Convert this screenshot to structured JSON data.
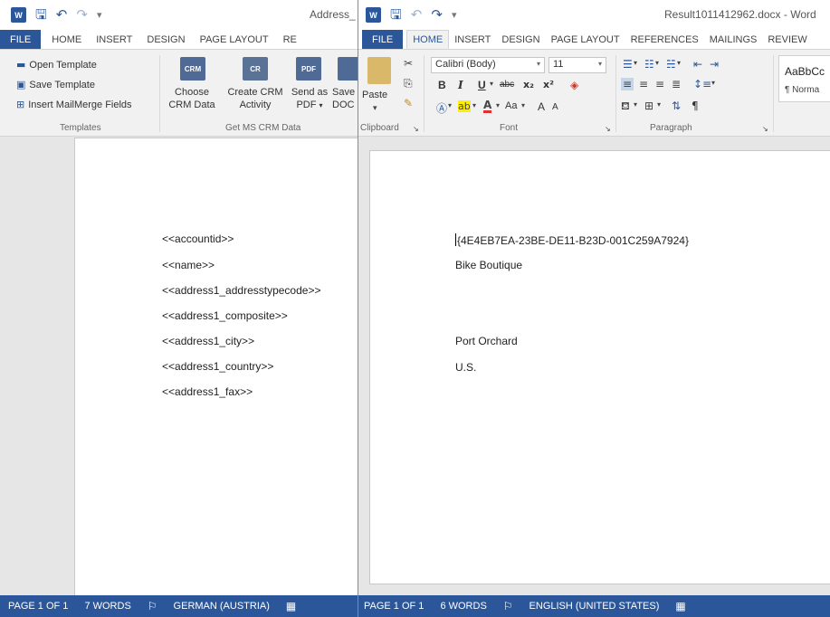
{
  "left_window": {
    "doc_title": "Address_",
    "tabs": [
      "FILE",
      "HOME",
      "INSERT",
      "DESIGN",
      "PAGE LAYOUT",
      "RE"
    ],
    "ribbon": {
      "open_template": "Open Template",
      "save_template": "Save Template",
      "insert_mailmerge": "Insert MailMerge Fields",
      "group_templates": "Templates",
      "choose_crm_1": "Choose",
      "choose_crm_2": "CRM Data",
      "create_activity_1": "Create CRM",
      "create_activity_2": "Activity",
      "send_pdf_1": "Send as",
      "send_pdf_2": "PDF",
      "save_doc_1": "Save",
      "save_doc_2": "DOC",
      "group_get_crm": "Get MS CRM Data",
      "icon_crm": "CRM",
      "icon_cr": "CR",
      "icon_pdf": "PDF"
    },
    "document_lines": [
      "<<accountid>>",
      "<<name>>",
      "<<address1_addresstypecode>>",
      "<<address1_composite>>",
      "<<address1_city>>",
      "<<address1_country>>",
      "<<address1_fax>>"
    ],
    "status": {
      "page": "PAGE 1 OF 1",
      "words": "7 WORDS",
      "language": "GERMAN (AUSTRIA)"
    }
  },
  "right_window": {
    "doc_title": "Result1011412962.docx - Word",
    "tabs": [
      "FILE",
      "HOME",
      "INSERT",
      "DESIGN",
      "PAGE LAYOUT",
      "REFERENCES",
      "MAILINGS",
      "REVIEW"
    ],
    "ribbon": {
      "paste": "Paste",
      "font_name": "Calibri (Body)",
      "font_size": "11",
      "group_clipboard": "Clipboard",
      "group_font": "Font",
      "group_paragraph": "Paragraph",
      "style_preview": "AaBbCc",
      "style_name": "¶ Norma",
      "bold": "B",
      "italic": "I",
      "underline": "U",
      "strikethrough": "abc",
      "subscript": "x₂",
      "superscript": "x²",
      "change_case": "Aa",
      "grow_font": "A",
      "shrink_font": "A",
      "pilcrow": "¶"
    },
    "document_lines": [
      "{4E4EB7EA-23BE-DE11-B23D-001C259A7924}",
      "Bike Boutique",
      "",
      "",
      "Port Orchard",
      "U.S."
    ],
    "status": {
      "page": "PAGE 1 OF 1",
      "words": "6 WORDS",
      "language": "ENGLISH (UNITED STATES)"
    }
  },
  "colors": {
    "word_blue": "#2b579a",
    "ribbon_bg": "#f1f1f1"
  }
}
